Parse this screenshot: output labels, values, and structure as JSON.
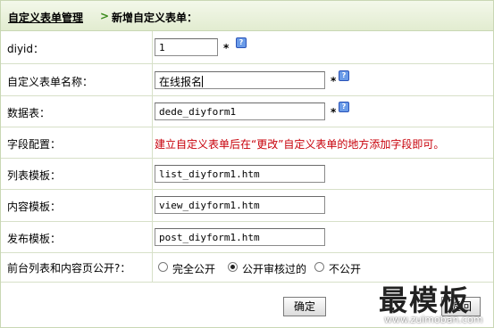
{
  "breadcrumb": {
    "link": "自定义表单管理",
    "separator": ">",
    "current": "新增自定义表单："
  },
  "form": {
    "diyid": {
      "label": "diyid：",
      "value": "1",
      "required": "*"
    },
    "name": {
      "label": "自定义表单名称：",
      "value": "在线报名",
      "required": "*"
    },
    "table": {
      "label": "数据表：",
      "value": "dede_diyform1",
      "required": "*"
    },
    "fields": {
      "label": "字段配置：",
      "hint": "建立自定义表单后在“更改”自定义表单的地方添加字段即可。"
    },
    "list_tpl": {
      "label": "列表模板：",
      "value": "list_diyform1.htm"
    },
    "view_tpl": {
      "label": "内容模板：",
      "value": "view_diyform1.htm"
    },
    "post_tpl": {
      "label": "发布模板：",
      "value": "post_diyform1.htm"
    },
    "public": {
      "label": "前台列表和内容页公开?：",
      "options": [
        "完全公开",
        "公开审核过的",
        "不公开"
      ],
      "selected": "公开审核过的"
    }
  },
  "buttons": {
    "ok": "确定",
    "back": "返回"
  },
  "watermark": {
    "text": "最模板",
    "url": "www.zuimoban.com"
  },
  "icons": {
    "help": "help-icon"
  },
  "colors": {
    "hint": "#c8000a",
    "accent": "#3a8a1c",
    "header_bg": "#e8f0da"
  }
}
